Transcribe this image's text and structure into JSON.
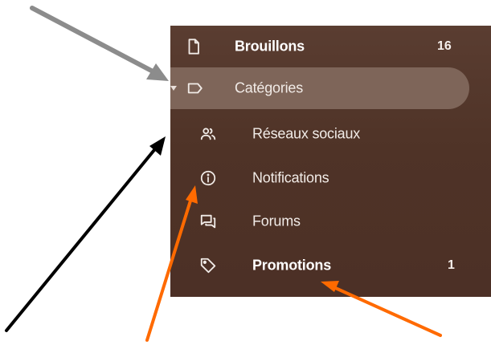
{
  "sidebar": {
    "items": [
      {
        "label": "Brouillons",
        "count": "16",
        "icon": "draft-file-icon"
      },
      {
        "label": "Catégories",
        "icon": "label-icon"
      },
      {
        "label": "Réseaux sociaux",
        "icon": "people-icon"
      },
      {
        "label": "Notifications",
        "icon": "info-icon"
      },
      {
        "label": "Forums",
        "icon": "forum-icon"
      },
      {
        "label": "Promotions",
        "count": "1",
        "icon": "tag-icon"
      }
    ]
  },
  "colors": {
    "panel_background": "#4f3327",
    "selected_pill": "#7e6559",
    "text": "#f1ebe7",
    "arrow_gray": "#8c8c8c",
    "arrow_black": "#000000",
    "arrow_orange": "#ff6a00"
  }
}
